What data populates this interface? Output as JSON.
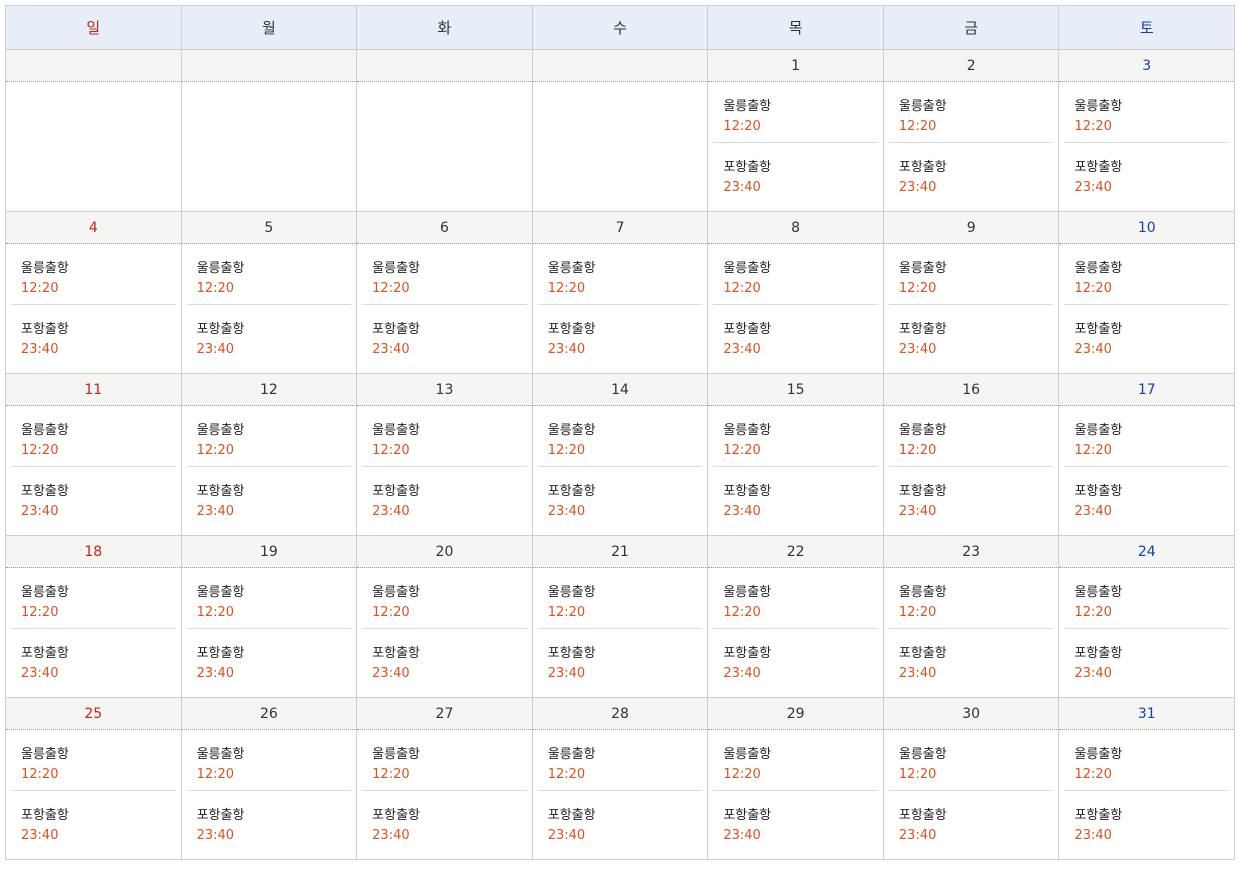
{
  "weekdays": [
    "일",
    "월",
    "화",
    "수",
    "목",
    "금",
    "토"
  ],
  "weeks": [
    [
      null,
      null,
      null,
      null,
      "1",
      "2",
      "3"
    ],
    [
      "4",
      "5",
      "6",
      "7",
      "8",
      "9",
      "10"
    ],
    [
      "11",
      "12",
      "13",
      "14",
      "15",
      "16",
      "17"
    ],
    [
      "18",
      "19",
      "20",
      "21",
      "22",
      "23",
      "24"
    ],
    [
      "25",
      "26",
      "27",
      "28",
      "29",
      "30",
      "31"
    ]
  ],
  "schedule": [
    {
      "name": "울릉출항",
      "time": "12:20"
    },
    {
      "name": "포항출항",
      "time": "23:40"
    }
  ],
  "colors": {
    "sunday": "#cc2211",
    "saturday": "#1144aa",
    "time": "#d9531e",
    "header_bg": "#e8eef8"
  }
}
